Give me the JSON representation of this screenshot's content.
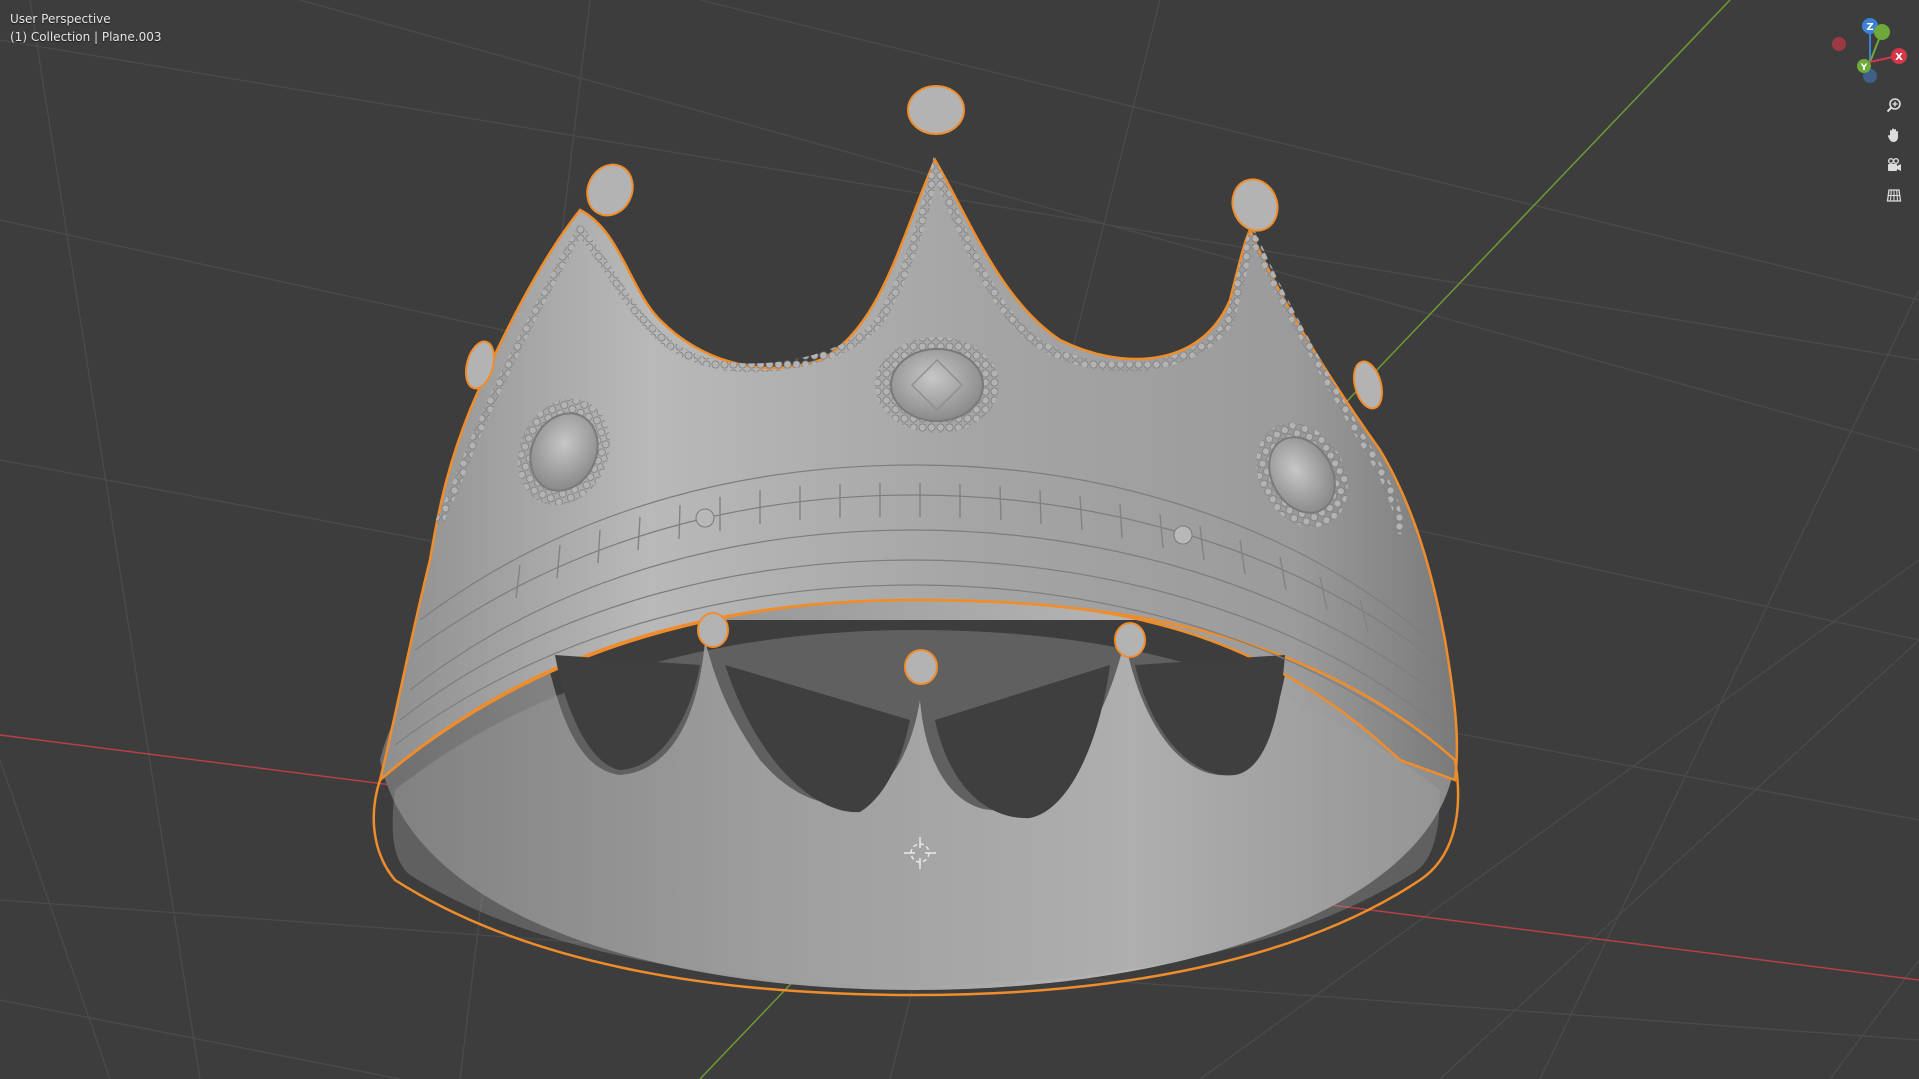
{
  "viewport": {
    "view_name": "User Perspective",
    "collection_info": "(1) Collection | Plane.003"
  },
  "gizmo": {
    "axes": [
      {
        "label": "Z",
        "color": "#3b82d6"
      },
      {
        "label": "Y",
        "color": "#6fa83b"
      },
      {
        "label": "X",
        "color": "#d4364a"
      }
    ]
  },
  "tools": [
    {
      "icon": "zoom-icon"
    },
    {
      "icon": "pan-hand-icon"
    },
    {
      "icon": "camera-icon"
    },
    {
      "icon": "grid-ortho-icon"
    }
  ],
  "colors": {
    "background": "#3d3d3d",
    "grid": "#4a4a4a",
    "x_axis": "#b54145",
    "y_axis": "#6f9a34",
    "selection_outline": "#f08d2b",
    "mesh": "#a9a9a9"
  }
}
